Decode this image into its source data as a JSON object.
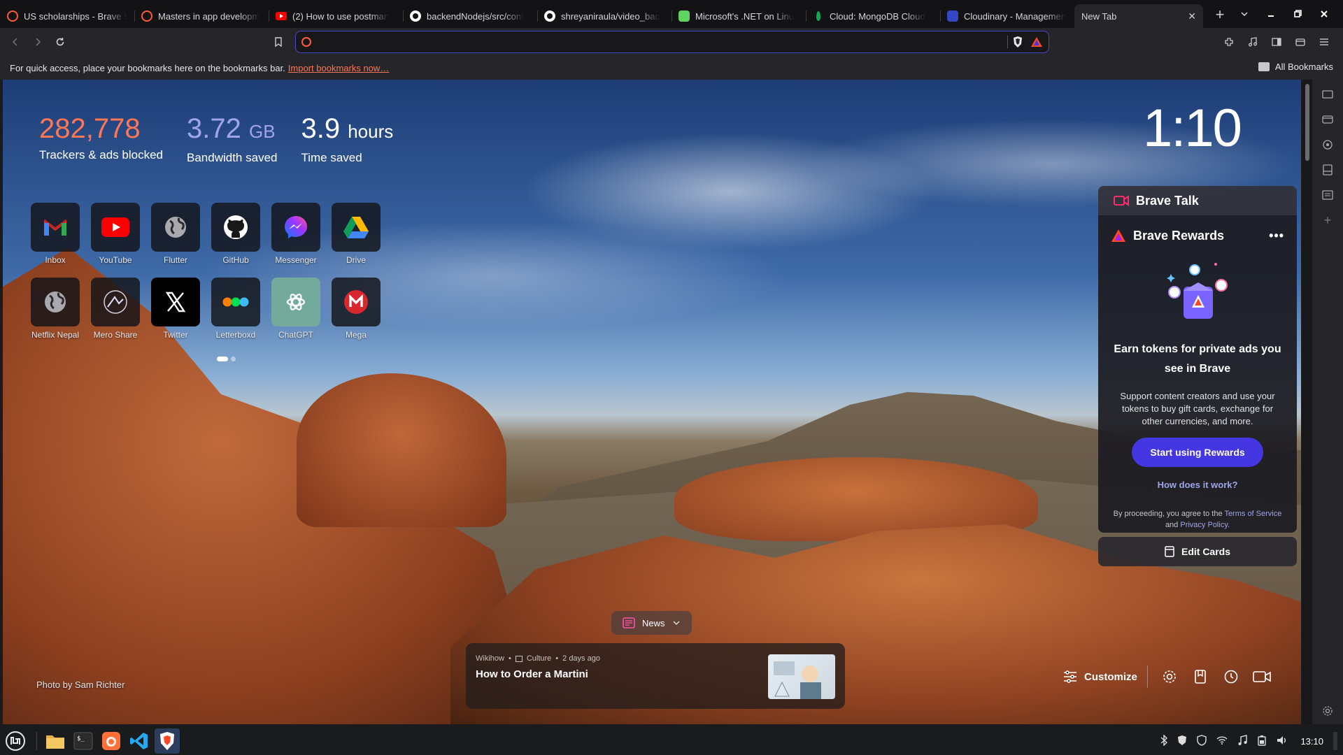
{
  "tabs": [
    {
      "title": "US scholarships - Brave S",
      "icon": "brave-search-icon",
      "color": "#ff5a3c"
    },
    {
      "title": "Masters in app developm",
      "icon": "brave-search-icon",
      "color": "#ff5a3c"
    },
    {
      "title": "(2) How to use postman",
      "icon": "youtube-icon",
      "color": "#ff0000"
    },
    {
      "title": "backendNodejs/src/cont",
      "icon": "github-icon",
      "color": "#ffffff"
    },
    {
      "title": "shreyaniraula/video_bac",
      "icon": "github-icon",
      "color": "#ffffff"
    },
    {
      "title": "Microsoft's .NET on Linu",
      "icon": "site-icon",
      "color": "#5fd35f"
    },
    {
      "title": "Cloud: MongoDB Cloud",
      "icon": "mongodb-icon",
      "color": "#13aa52"
    },
    {
      "title": "Cloudinary - Managemen",
      "icon": "cloudinary-icon",
      "color": "#3448c5"
    },
    {
      "title": "New Tab",
      "icon": "",
      "color": "",
      "active": true
    }
  ],
  "address_bar": {
    "value": "",
    "placeholder": ""
  },
  "bookmarks_bar": {
    "message": "For quick access, place your bookmarks here on the bookmarks bar.",
    "import_link": "Import bookmarks now…",
    "all_bookmarks": "All Bookmarks"
  },
  "stats": {
    "trackers": {
      "value": "282,778",
      "label": "Trackers & ads blocked"
    },
    "bandwidth": {
      "value": "3.72",
      "unit": "GB",
      "label": "Bandwidth saved"
    },
    "time": {
      "value": "3.9",
      "unit": "hours",
      "label": "Time saved"
    }
  },
  "top_sites": [
    {
      "name": "Inbox",
      "icon": "gmail-icon"
    },
    {
      "name": "YouTube",
      "icon": "youtube-icon"
    },
    {
      "name": "Flutter",
      "icon": "globe-icon"
    },
    {
      "name": "GitHub",
      "icon": "github-icon"
    },
    {
      "name": "Messenger",
      "icon": "messenger-icon"
    },
    {
      "name": "Drive",
      "icon": "google-drive-icon"
    },
    {
      "name": "Netflix Nepal",
      "icon": "globe-icon"
    },
    {
      "name": "Mero Share",
      "icon": "mero-share-icon"
    },
    {
      "name": "Twitter",
      "icon": "x-icon"
    },
    {
      "name": "Letterboxd",
      "icon": "letterboxd-icon"
    },
    {
      "name": "ChatGPT",
      "icon": "chatgpt-icon"
    },
    {
      "name": "Mega",
      "icon": "mega-icon"
    }
  ],
  "clock": "1:10",
  "brave_talk": {
    "title": "Brave Talk"
  },
  "brave_rewards": {
    "title": "Brave Rewards",
    "more": "•••",
    "headline": "Earn tokens for private ads you see in Brave",
    "description": "Support content creators and use your tokens to buy gift cards, exchange for other currencies, and more.",
    "cta": "Start using Rewards",
    "how_link": "How does it work?",
    "legal_prefix": "By proceeding, you agree to the",
    "terms": "Terms of Service",
    "legal_and": "and",
    "privacy": "Privacy Policy."
  },
  "edit_cards": "Edit Cards",
  "photo_credit": "Photo by Sam Richter",
  "news": {
    "pill": "News",
    "source": "Wikihow",
    "category": "Culture",
    "age": "2 days ago",
    "title": "How to Order a Martini"
  },
  "customize": "Customize",
  "taskbar": {
    "apps": [
      "mint-menu-icon",
      "files-icon",
      "terminal-icon",
      "firefox-icon",
      "vscode-icon",
      "brave-icon"
    ],
    "time": "13:10"
  }
}
